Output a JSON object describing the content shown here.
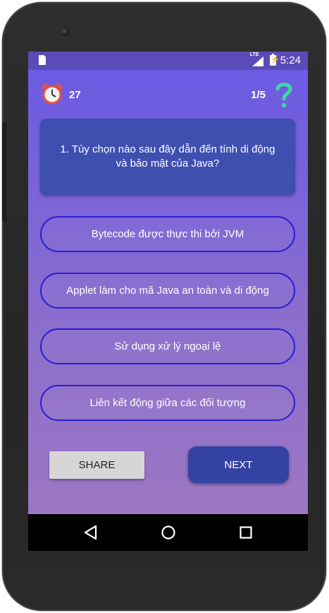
{
  "status_bar": {
    "network": "LTE",
    "time": "5:24"
  },
  "header": {
    "timer_icon": "alarm-clock-icon",
    "timer_value": "27",
    "progress": "1/5",
    "help_icon": "question-mark-icon"
  },
  "question": {
    "text": "1. Tùy chọn nào sau đây dẫn đến tính di động\nvà bảo mật của Java?"
  },
  "options": [
    {
      "label": "Bytecode được thực thi bởi JVM"
    },
    {
      "label": "Applet làm cho mã Java an toàn và di động"
    },
    {
      "label": "Sử dụng xử lý ngoại lệ"
    },
    {
      "label": "Liên kết động giữa các đối tượng"
    }
  ],
  "buttons": {
    "share_label": "SHARE",
    "next_label": "NEXT"
  },
  "colors": {
    "background_top": "#6b5be3",
    "background_bottom": "#9c77c2",
    "question_card": "#3f4fb0",
    "option_border": "#2a1ed2",
    "next_button": "#3443a3",
    "share_button": "#d6d6d6",
    "help_icon": "#3fd6a0",
    "timer_icon": "#e8503f"
  },
  "nav": {
    "back_icon": "back-triangle-icon",
    "home_icon": "home-circle-icon",
    "recent_icon": "recent-apps-square-icon"
  }
}
